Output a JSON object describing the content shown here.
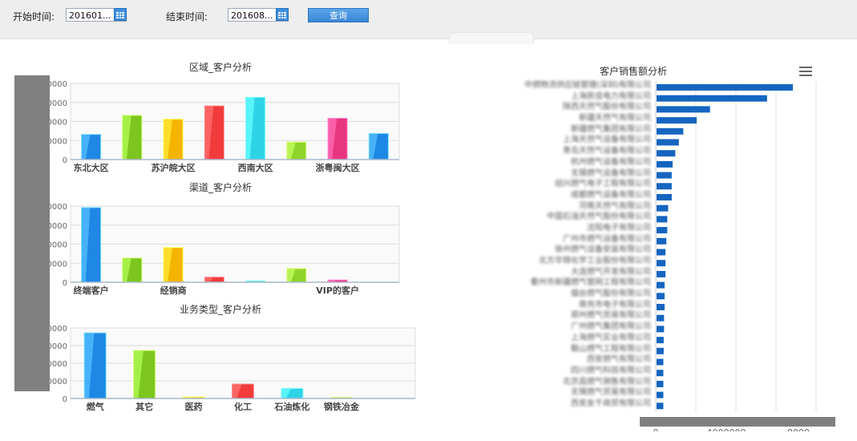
{
  "filters": {
    "start_label": "开始时间:",
    "start_value": "201601...",
    "end_label": "结束时间:",
    "end_value": "201608...",
    "query_label": "查询"
  },
  "charts": {
    "region_title": "区域_客户分析",
    "channel_title": "渠道_客户分析",
    "business_title": "业务类型_客户分析",
    "sales_title": "客户销售额分析"
  },
  "chart_data": [
    {
      "type": "bar",
      "title": "区域_客户分析",
      "categories": [
        "东北大区",
        "",
        "苏沪皖大区",
        "",
        "西南大区",
        "",
        "浙粤闽大区",
        ""
      ],
      "values": [
        13000,
        23000,
        21000,
        28000,
        32500,
        9000,
        21500,
        13500
      ],
      "colors": [
        "#1e88e5",
        "#7cc61f",
        "#f5b400",
        "#f23b3b",
        "#2fd3e6",
        "#8ed42a",
        "#e8367e",
        "#1e88e5"
      ],
      "ylim": [
        0,
        40000
      ],
      "tick_labels": [
        "0",
        "0000",
        "0000",
        "0000",
        "0000"
      ]
    },
    {
      "type": "bar",
      "title": "渠道_客户分析",
      "categories": [
        "终端客户",
        "",
        "经销商",
        "",
        "",
        "",
        "VIP的客户",
        ""
      ],
      "values": [
        39000,
        12500,
        18000,
        2500,
        500,
        7000,
        1000,
        0
      ],
      "colors": [
        "#1e88e5",
        "#7cc61f",
        "#f5b400",
        "#f23b3b",
        "#2fd3e6",
        "#8ed42a",
        "#e8367e",
        "#1e88e5"
      ],
      "ylim": [
        0,
        40000
      ],
      "tick_labels": [
        "0",
        "0000",
        "0000",
        "0000",
        "0000"
      ]
    },
    {
      "type": "bar",
      "title": "业务类型_客户分析",
      "categories": [
        "燃气",
        "其它",
        "医药",
        "化工",
        "石油炼化",
        "钢铁冶金",
        ""
      ],
      "values": [
        37000,
        27000,
        600,
        8000,
        5500,
        500,
        0
      ],
      "colors": [
        "#1e88e5",
        "#7cc61f",
        "#f5b400",
        "#f23b3b",
        "#2fd3e6",
        "#8ed42a",
        "#e8367e"
      ],
      "ylim": [
        0,
        40000
      ],
      "tick_labels": [
        "0",
        "0000",
        "0000",
        "0000",
        "0000"
      ]
    },
    {
      "type": "bar",
      "orientation": "horizontal",
      "title": "客户销售额分析",
      "categories": [
        "中燃物流供应链管理(深圳)有限公司",
        "上海民佳电力有限公司",
        "陕西天然气股份有限公司",
        "新疆天然气有限公司",
        "新疆燃气集团有限公司",
        "上海天然气设备有限公司",
        "青岛天然气设备有限公司",
        "杭州燃气设备有限公司",
        "无锡燃气设备有限公司",
        "绍兴燃气电子工程有限公司",
        "成都燃气设备有限公司",
        "河南天然气有限公司",
        "中国石油天然气股份有限公司",
        "沈阳电子有限公司",
        "广州市燃气设备有限公司",
        "徐州燃气设备安装有限公司",
        "北方华锦化学工业股份有限公司",
        "大连燃气开发有限公司",
        "衢州市新疆燃气管网工程有限公司",
        "烟台燃气股份有限公司",
        "南充市电子有限公司",
        "郑州燃气贸易有限公司",
        "广州燃气集团有限公司",
        "上海燃气实业有限公司",
        "鞍山燃气工程有限公司",
        "西安燃气有限公司",
        "四川燃气科技有限公司",
        "北京昌燃气销售有限公司",
        "无锡燃气贸易有限公司",
        "西安友千商贸有限公司"
      ],
      "values": [
        7650000,
        6200000,
        3000000,
        2250000,
        1500000,
        1250000,
        1050000,
        900000,
        850000,
        850000,
        850000,
        650000,
        600000,
        600000,
        550000,
        500000,
        500000,
        500000,
        450000,
        450000,
        450000,
        420000,
        420000,
        400000,
        400000,
        380000,
        380000,
        380000,
        380000,
        380000
      ],
      "color": "#1565c0",
      "xlim": [
        0,
        9000000
      ],
      "tick_labels": [
        "0",
        "4000000",
        "8000"
      ]
    }
  ]
}
